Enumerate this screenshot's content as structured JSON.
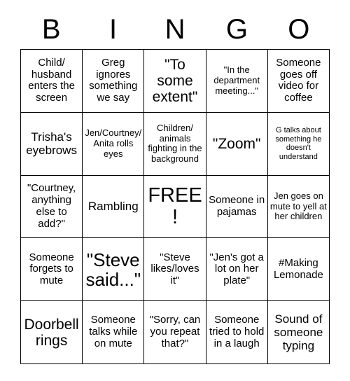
{
  "card": {
    "title": "BINGO",
    "header_letters": [
      "B",
      "I",
      "N",
      "G",
      "O"
    ],
    "colors": {
      "background": "#ffffff",
      "border": "#000000",
      "text": "#000000"
    },
    "free_space": {
      "row": 3,
      "column": 3,
      "label": "FREE!"
    },
    "rows": [
      [
        {
          "text": "Child/ husband enters the screen",
          "size": "md"
        },
        {
          "text": "Greg ignores something we say",
          "size": "md"
        },
        {
          "text": "\"To some extent\"",
          "size": "xl"
        },
        {
          "text": "\"In the department meeting...\"",
          "size": "sm"
        },
        {
          "text": "Someone goes off video for coffee",
          "size": "md"
        }
      ],
      [
        {
          "text": "Trisha's eyebrows",
          "size": "lg"
        },
        {
          "text": "Jen/Courtney/ Anita rolls eyes",
          "size": "sm"
        },
        {
          "text": "Children/ animals fighting in the background",
          "size": "sm"
        },
        {
          "text": "\"Zoom\"",
          "size": "xl"
        },
        {
          "text": "G talks about something he doesn't understand",
          "size": "xs"
        }
      ],
      [
        {
          "text": "\"Courtney, anything else to add?\"",
          "size": "md"
        },
        {
          "text": "Rambling",
          "size": "lg"
        },
        {
          "text": "FREE!",
          "size": "3xl"
        },
        {
          "text": "Someone in pajamas",
          "size": "md"
        },
        {
          "text": "Jen goes on mute to yell at her children",
          "size": "sm"
        }
      ],
      [
        {
          "text": "Someone forgets to mute",
          "size": "md"
        },
        {
          "text": "\"Steve said...\"",
          "size": "2xl"
        },
        {
          "text": "\"Steve likes/loves it\"",
          "size": "md"
        },
        {
          "text": "\"Jen's got a lot on her plate\"",
          "size": "md"
        },
        {
          "text": "#Making Lemonade",
          "size": "md"
        }
      ],
      [
        {
          "text": "Doorbell rings",
          "size": "xl"
        },
        {
          "text": "Someone talks while on mute",
          "size": "md"
        },
        {
          "text": "\"Sorry, can you repeat that?\"",
          "size": "md"
        },
        {
          "text": "Someone tried to hold in a laugh",
          "size": "md"
        },
        {
          "text": "Sound of someone typing",
          "size": "lg"
        }
      ]
    ]
  }
}
